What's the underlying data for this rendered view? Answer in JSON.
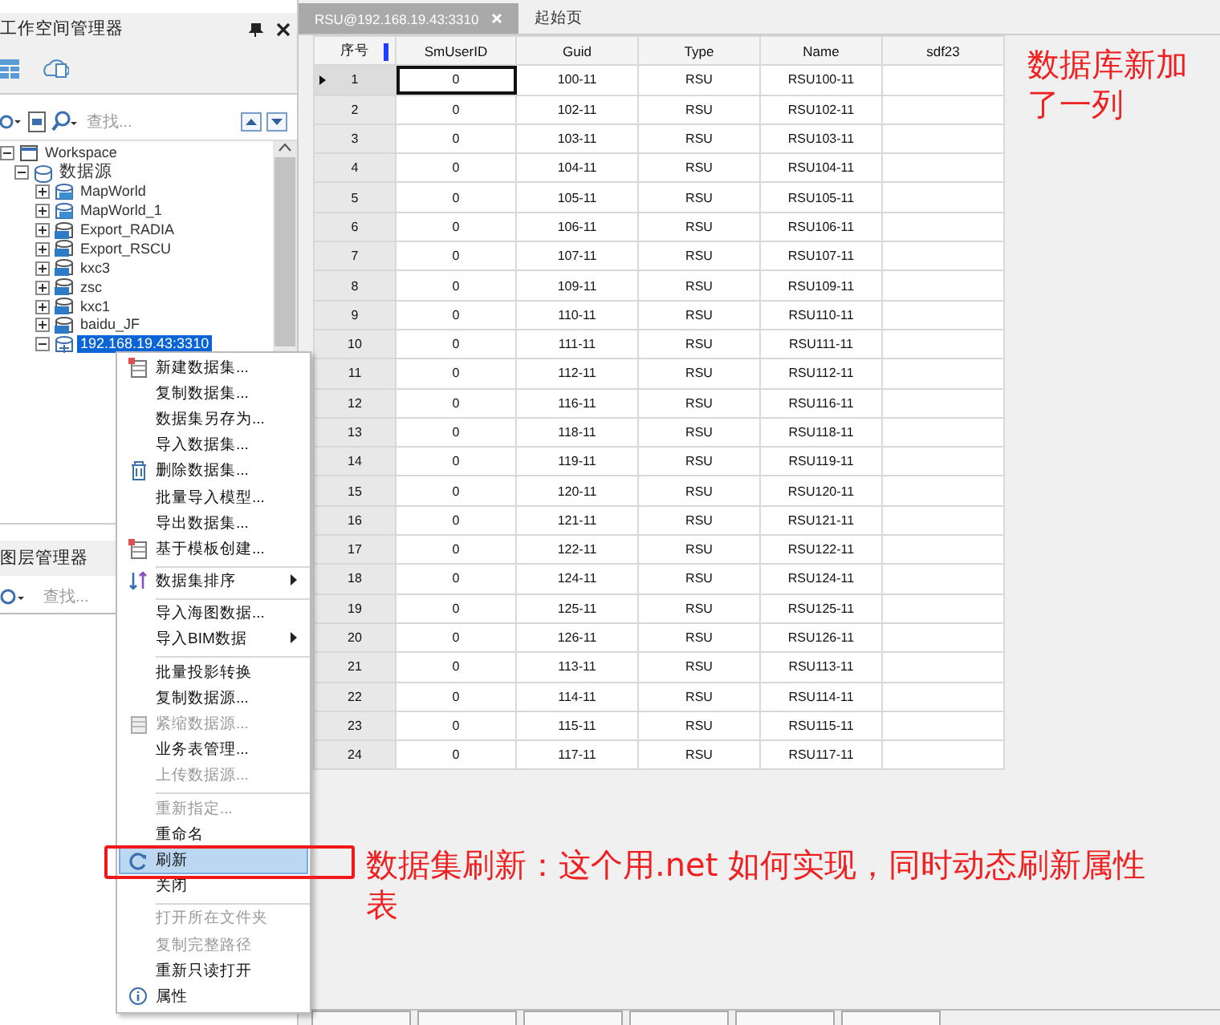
{
  "workspace_panel": {
    "title": "工作空间管理器",
    "search": {
      "placeholder": "查找..."
    },
    "tree": [
      {
        "label": "Workspace",
        "kind": "workspace",
        "expanded": true,
        "selected": false,
        "children": [
          {
            "label": "数据源",
            "kind": "sources",
            "expanded": true,
            "selected": false,
            "children": [
              {
                "label": "MapWorld",
                "kind": "web",
                "expanded": false,
                "selected": false
              },
              {
                "label": "MapWorld_1",
                "kind": "web",
                "expanded": false,
                "selected": false
              },
              {
                "label": "Export_RADIA",
                "kind": "udb",
                "expanded": false,
                "selected": false
              },
              {
                "label": "Export_RSCU",
                "kind": "udb",
                "expanded": false,
                "selected": false
              },
              {
                "label": "kxc3",
                "kind": "udb",
                "expanded": false,
                "selected": false
              },
              {
                "label": "zsc",
                "kind": "udb",
                "expanded": false,
                "selected": false
              },
              {
                "label": "kxc1",
                "kind": "udb",
                "expanded": false,
                "selected": false
              },
              {
                "label": "baidu_JF",
                "kind": "udb",
                "expanded": false,
                "selected": false
              },
              {
                "label": "192.168.19.43:3310",
                "kind": "db",
                "expanded": true,
                "selected": true
              }
            ]
          }
        ]
      }
    ]
  },
  "layer_panel": {
    "title": "图层管理器",
    "search": {
      "placeholder": "查找..."
    }
  },
  "tabs": [
    {
      "label": "RSU@192.168.19.43:3310",
      "closable": true,
      "selected": true
    },
    {
      "label": "起始页",
      "closable": false,
      "selected": false
    }
  ],
  "table": {
    "columns": [
      "序号",
      "SmUserID",
      "Guid",
      "Type",
      "Name",
      "sdf23"
    ],
    "rows": [
      {
        "cells": [
          "1",
          "0",
          "100-11",
          "RSU",
          "RSU100-11",
          ""
        ],
        "selected": true
      },
      {
        "cells": [
          "2",
          "0",
          "102-11",
          "RSU",
          "RSU102-11",
          ""
        ],
        "selected": false
      },
      {
        "cells": [
          "3",
          "0",
          "103-11",
          "RSU",
          "RSU103-11",
          ""
        ],
        "selected": false
      },
      {
        "cells": [
          "4",
          "0",
          "104-11",
          "RSU",
          "RSU104-11",
          ""
        ],
        "selected": false
      },
      {
        "cells": [
          "5",
          "0",
          "105-11",
          "RSU",
          "RSU105-11",
          ""
        ],
        "selected": false
      },
      {
        "cells": [
          "6",
          "0",
          "106-11",
          "RSU",
          "RSU106-11",
          ""
        ],
        "selected": false
      },
      {
        "cells": [
          "7",
          "0",
          "107-11",
          "RSU",
          "RSU107-11",
          ""
        ],
        "selected": false
      },
      {
        "cells": [
          "8",
          "0",
          "109-11",
          "RSU",
          "RSU109-11",
          ""
        ],
        "selected": false
      },
      {
        "cells": [
          "9",
          "0",
          "110-11",
          "RSU",
          "RSU110-11",
          ""
        ],
        "selected": false
      },
      {
        "cells": [
          "10",
          "0",
          "111-11",
          "RSU",
          "RSU111-11",
          ""
        ],
        "selected": false
      },
      {
        "cells": [
          "11",
          "0",
          "112-11",
          "RSU",
          "RSU112-11",
          ""
        ],
        "selected": false
      },
      {
        "cells": [
          "12",
          "0",
          "116-11",
          "RSU",
          "RSU116-11",
          ""
        ],
        "selected": false
      },
      {
        "cells": [
          "13",
          "0",
          "118-11",
          "RSU",
          "RSU118-11",
          ""
        ],
        "selected": false
      },
      {
        "cells": [
          "14",
          "0",
          "119-11",
          "RSU",
          "RSU119-11",
          ""
        ],
        "selected": false
      },
      {
        "cells": [
          "15",
          "0",
          "120-11",
          "RSU",
          "RSU120-11",
          ""
        ],
        "selected": false
      },
      {
        "cells": [
          "16",
          "0",
          "121-11",
          "RSU",
          "RSU121-11",
          ""
        ],
        "selected": false
      },
      {
        "cells": [
          "17",
          "0",
          "122-11",
          "RSU",
          "RSU122-11",
          ""
        ],
        "selected": false
      },
      {
        "cells": [
          "18",
          "0",
          "124-11",
          "RSU",
          "RSU124-11",
          ""
        ],
        "selected": false
      },
      {
        "cells": [
          "19",
          "0",
          "125-11",
          "RSU",
          "RSU125-11",
          ""
        ],
        "selected": false
      },
      {
        "cells": [
          "20",
          "0",
          "126-11",
          "RSU",
          "RSU126-11",
          ""
        ],
        "selected": false
      },
      {
        "cells": [
          "21",
          "0",
          "113-11",
          "RSU",
          "RSU113-11",
          ""
        ],
        "selected": false
      },
      {
        "cells": [
          "22",
          "0",
          "114-11",
          "RSU",
          "RSU114-11",
          ""
        ],
        "selected": false
      },
      {
        "cells": [
          "23",
          "0",
          "115-11",
          "RSU",
          "RSU115-11",
          ""
        ],
        "selected": false
      },
      {
        "cells": [
          "24",
          "0",
          "117-11",
          "RSU",
          "RSU117-11",
          ""
        ],
        "selected": false
      }
    ]
  },
  "context_menu": [
    {
      "kind": "item",
      "label": "新建数据集...",
      "disabled": false,
      "selected": false,
      "submenu": false
    },
    {
      "kind": "item",
      "label": "复制数据集...",
      "disabled": false,
      "selected": false,
      "submenu": false
    },
    {
      "kind": "item",
      "label": "数据集另存为...",
      "disabled": false,
      "selected": false,
      "submenu": false
    },
    {
      "kind": "item",
      "label": "导入数据集...",
      "disabled": false,
      "selected": false,
      "submenu": false
    },
    {
      "kind": "item",
      "label": "删除数据集...",
      "disabled": false,
      "selected": false,
      "submenu": false
    },
    {
      "kind": "item",
      "label": "批量导入模型...",
      "disabled": false,
      "selected": false,
      "submenu": false
    },
    {
      "kind": "item",
      "label": "导出数据集...",
      "disabled": false,
      "selected": false,
      "submenu": false
    },
    {
      "kind": "item",
      "label": "基于模板创建...",
      "disabled": false,
      "selected": false,
      "submenu": false
    },
    {
      "kind": "separator"
    },
    {
      "kind": "item",
      "label": "数据集排序",
      "disabled": false,
      "selected": false,
      "submenu": true
    },
    {
      "kind": "separator"
    },
    {
      "kind": "item",
      "label": "导入海图数据...",
      "disabled": false,
      "selected": false,
      "submenu": false
    },
    {
      "kind": "item",
      "label": "导入BIM数据",
      "disabled": false,
      "selected": false,
      "submenu": true
    },
    {
      "kind": "separator"
    },
    {
      "kind": "item",
      "label": "批量投影转换",
      "disabled": false,
      "selected": false,
      "submenu": false
    },
    {
      "kind": "item",
      "label": "复制数据源...",
      "disabled": false,
      "selected": false,
      "submenu": false
    },
    {
      "kind": "item",
      "label": "紧缩数据源...",
      "disabled": true,
      "selected": false,
      "submenu": false
    },
    {
      "kind": "item",
      "label": "业务表管理...",
      "disabled": false,
      "selected": false,
      "submenu": false
    },
    {
      "kind": "item",
      "label": "上传数据源...",
      "disabled": true,
      "selected": false,
      "submenu": false
    },
    {
      "kind": "separator"
    },
    {
      "kind": "item",
      "label": "重新指定...",
      "disabled": true,
      "selected": false,
      "submenu": false
    },
    {
      "kind": "item",
      "label": "重命名",
      "disabled": false,
      "selected": false,
      "submenu": false
    },
    {
      "kind": "item",
      "label": "刷新",
      "disabled": false,
      "selected": true,
      "submenu": false
    },
    {
      "kind": "item",
      "label": "关闭",
      "disabled": false,
      "selected": false,
      "submenu": false
    },
    {
      "kind": "separator"
    },
    {
      "kind": "item",
      "label": "打开所在文件夹",
      "disabled": true,
      "selected": false,
      "submenu": false
    },
    {
      "kind": "item",
      "label": "复制完整路径",
      "disabled": true,
      "selected": false,
      "submenu": false
    },
    {
      "kind": "item",
      "label": "重新只读打开",
      "disabled": false,
      "selected": false,
      "submenu": false
    },
    {
      "kind": "item",
      "label": "属性",
      "disabled": false,
      "selected": false,
      "submenu": false
    }
  ],
  "annotations": [
    {
      "text": "数据库新加了一列"
    },
    {
      "text": "数据集刷新：这个用.net 如何实现，同时动态刷新属性表"
    }
  ]
}
